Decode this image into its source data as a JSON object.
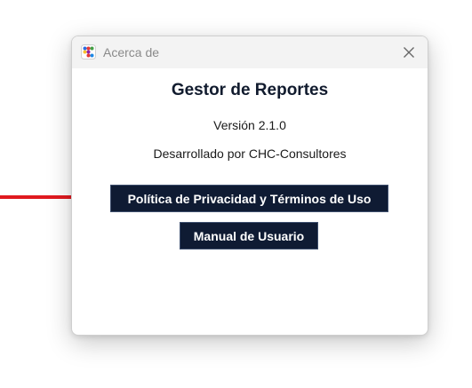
{
  "window": {
    "title": "Acerca de",
    "app_icon": "app-grid-icon",
    "close_icon": "close-icon"
  },
  "content": {
    "heading": "Gestor de Reportes",
    "version": "Versión 2.1.0",
    "developer": "Desarrollado por CHC-Consultores"
  },
  "buttons": {
    "privacy_label": "Política de Privacidad y Términos de Uso",
    "manual_label": "Manual de Usuario"
  },
  "colors": {
    "button_bg": "#0f1b33",
    "heading": "#111b2e",
    "annotation_arrow": "#e0191f",
    "titlebar_bg": "#f3f3f3"
  }
}
